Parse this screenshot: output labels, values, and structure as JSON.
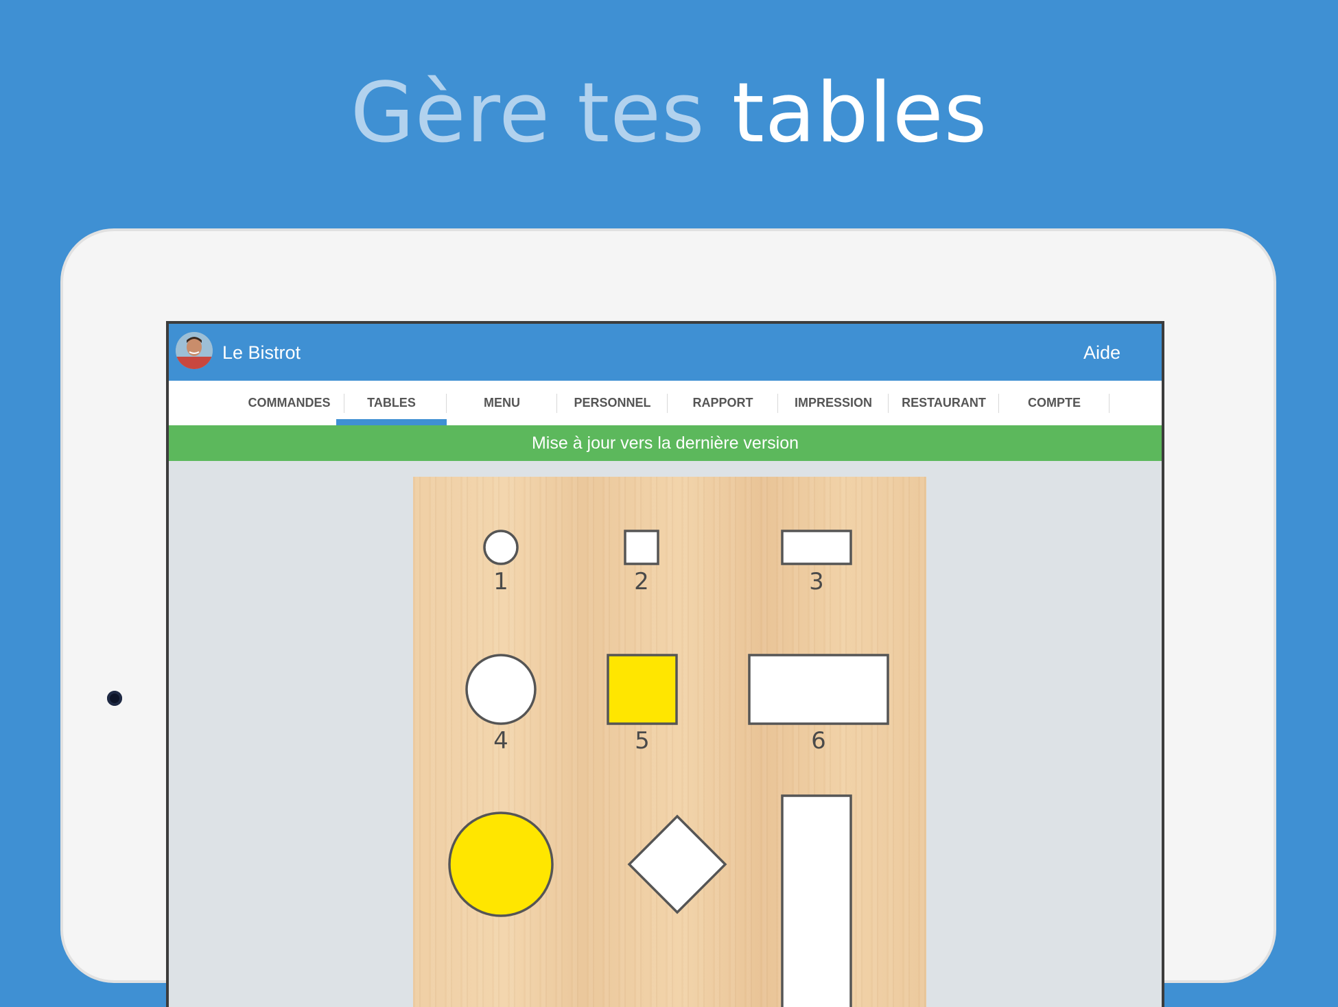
{
  "headline": {
    "light": "Gère tes",
    "bold": "tables"
  },
  "app": {
    "title": "Le Bistrot",
    "help": "Aide"
  },
  "tabs": [
    {
      "label": "COMMANDES",
      "active": false
    },
    {
      "label": "TABLES",
      "active": true
    },
    {
      "label": "MENU",
      "active": false
    },
    {
      "label": "PERSONNEL",
      "active": false
    },
    {
      "label": "RAPPORT",
      "active": false
    },
    {
      "label": "IMPRESSION",
      "active": false
    },
    {
      "label": "RESTAURANT",
      "active": false
    },
    {
      "label": "COMPTE",
      "active": false
    }
  ],
  "banner": "Mise à jour vers la dernière version",
  "tables": [
    {
      "number": "1",
      "shape": "circle",
      "status_color": "#ffffff"
    },
    {
      "number": "2",
      "shape": "square",
      "status_color": "#ffffff"
    },
    {
      "number": "3",
      "shape": "rectangle",
      "status_color": "#ffffff"
    },
    {
      "number": "4",
      "shape": "circle",
      "status_color": "#ffffff"
    },
    {
      "number": "5",
      "shape": "square",
      "status_color": "#ffe600"
    },
    {
      "number": "6",
      "shape": "rectangle",
      "status_color": "#ffffff"
    },
    {
      "number": "",
      "shape": "circle",
      "status_color": "#ffe600"
    },
    {
      "number": "",
      "shape": "diamond",
      "status_color": "#ffffff"
    },
    {
      "number": "",
      "shape": "rectangle-vertical",
      "status_color": "#ffffff"
    }
  ],
  "colors": {
    "brand": "#3f90d3",
    "banner": "#5cb85c",
    "occupied": "#ffe600"
  }
}
